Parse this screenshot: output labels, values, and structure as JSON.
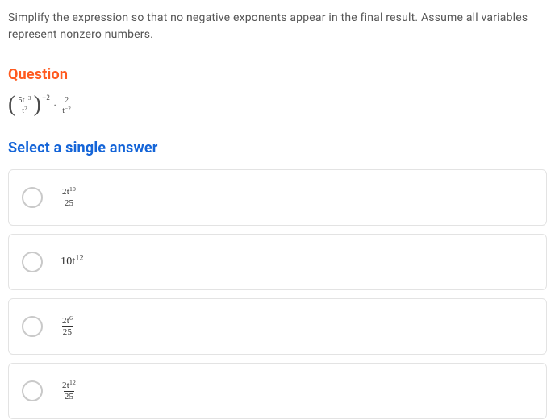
{
  "instructions": "Simplify the expression so that no negative exponents appear in the final result. Assume all variables represent nonzero numbers.",
  "questionHeading": "Question",
  "expression": {
    "paren": {
      "num": "5t",
      "numExp": "−3",
      "den": "t",
      "denExp": "2"
    },
    "outerExp": "−2",
    "second": {
      "num": "2",
      "den": "t",
      "denExp": "−2"
    }
  },
  "selectHeading": "Select a single answer",
  "options": [
    {
      "type": "frac",
      "num": "2t",
      "numExp": "10",
      "den": "25"
    },
    {
      "type": "plain",
      "coef": "10t",
      "exp": "12"
    },
    {
      "type": "frac",
      "num": "2t",
      "numExp": "6",
      "den": "25"
    },
    {
      "type": "frac",
      "num": "2t",
      "numExp": "12",
      "den": "25"
    }
  ]
}
